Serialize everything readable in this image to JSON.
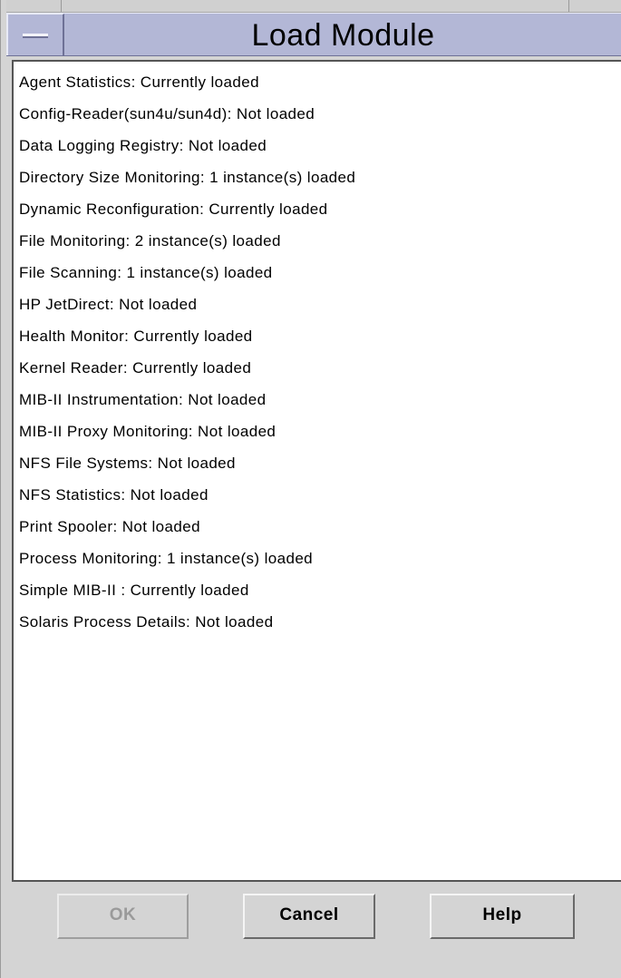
{
  "window": {
    "title": "Load Module"
  },
  "modules": [
    "Agent Statistics: Currently loaded",
    "Config-Reader(sun4u/sun4d): Not loaded",
    "Data Logging Registry: Not loaded",
    "Directory Size Monitoring: 1 instance(s) loaded",
    "Dynamic Reconfiguration: Currently loaded",
    "File Monitoring: 2 instance(s) loaded",
    "File Scanning: 1 instance(s) loaded",
    "HP JetDirect: Not loaded",
    "Health Monitor: Currently loaded",
    "Kernel Reader: Currently loaded",
    "MIB-II Instrumentation: Not loaded",
    "MIB-II Proxy Monitoring: Not loaded",
    "NFS File Systems: Not loaded",
    "NFS Statistics: Not loaded",
    "Print Spooler: Not loaded",
    "Process Monitoring: 1 instance(s) loaded",
    "Simple MIB-II : Currently loaded",
    "Solaris Process Details: Not loaded"
  ],
  "buttons": {
    "ok": "OK",
    "cancel": "Cancel",
    "help": "Help"
  },
  "colors": {
    "titlebar": "#b3b7d6",
    "window_background": "#d4d4d4",
    "disabled_text": "#9a9a9a"
  },
  "icons": {
    "window_menu": "window-menu-icon"
  }
}
